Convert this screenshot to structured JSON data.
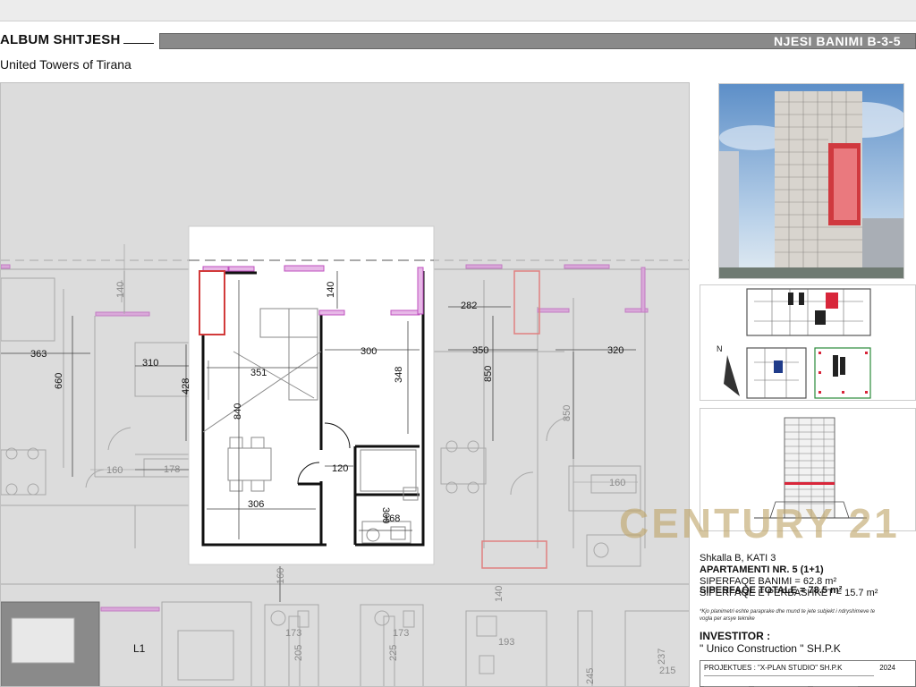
{
  "header": {
    "album": "ALBUM SHITJESH",
    "subtitle": "United  Towers of Tirana",
    "unit": "NJESI BANIMI B-3-5"
  },
  "plan": {
    "dimensions": [
      "140",
      "140",
      "363",
      "660",
      "310",
      "428",
      "351",
      "300",
      "348",
      "840",
      "120",
      "306",
      "300",
      "168",
      "178",
      "160",
      "282",
      "350",
      "850",
      "320",
      "850",
      "160",
      "160",
      "140",
      "173",
      "173",
      "205",
      "225",
      "193",
      "237",
      "215",
      "245"
    ],
    "label_l1": "L1"
  },
  "keyplan": {
    "north": "N"
  },
  "info": {
    "line1": "Shkalla B, KATI 3",
    "line2": "APARTAMENTI NR. 5 (1+1)",
    "line3": "SIPERFAQE BANIMI = 62.8 m²",
    "line4": "SIPERFAQE E PERBASHKET = 15.7 m²",
    "total": "SIPERFAQE TOTALE = 78.5 m²",
    "note": "*Kjo planimetri eshte paraprake dhe mund te jete subjekt i ndryshimeve te vogla per arsye teknike",
    "investor_label": "INVESTITOR :",
    "investor": "\" Unico Construction \" SH.P.K"
  },
  "watermark": "CENTURY 21",
  "titleblock": {
    "projektues": "PROJEKTUES : \"X-PLAN STUDIO\" SH.P.K",
    "year": "2024"
  },
  "colors": {
    "wall": "#111111",
    "partition": "#c050c0",
    "column": "#d23a3a",
    "faded": "#9a9a9a",
    "bar": "#8a8a8a"
  }
}
